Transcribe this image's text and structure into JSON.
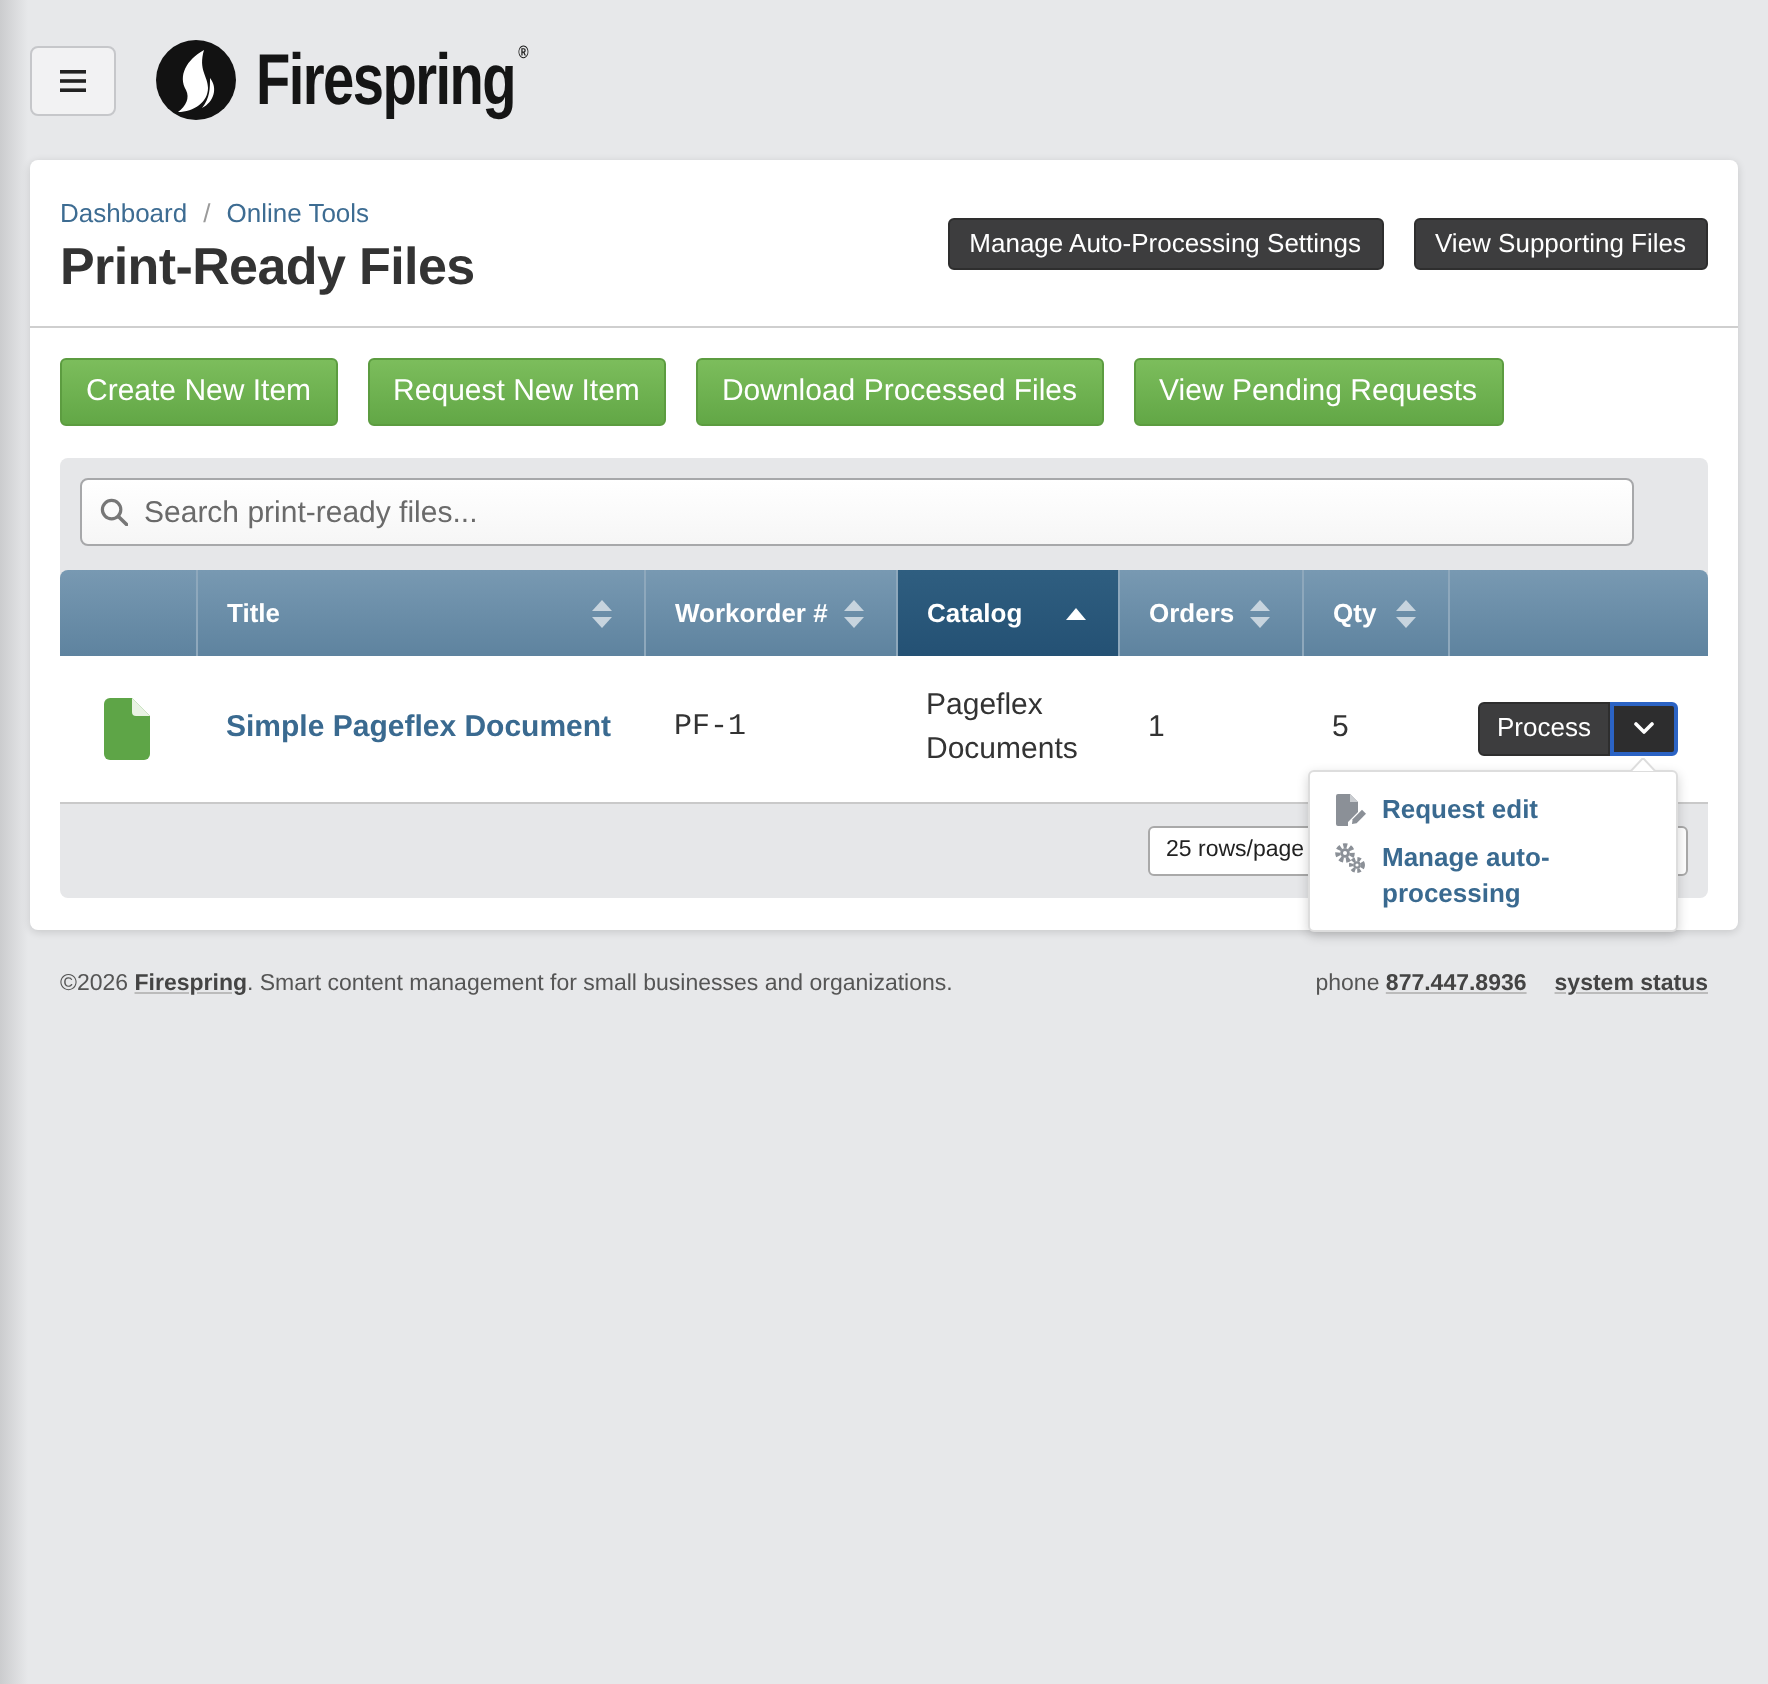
{
  "brand": "Firespring$^{®}$",
  "breadcrumb": [
    {
      "label": "Dashboard"
    },
    {
      "label": "Online Tools"
    }
  ],
  "breadcrumb_separator": "/",
  "page_title": "Print-Ready Files",
  "header_buttons": [
    "Manage Auto-Processing Settings",
    "View Supporting Files"
  ],
  "action_buttons": [
    "Create New Item",
    "Request New Item",
    "Download Processed Files",
    "View Pending Requests"
  ],
  "search": {
    "placeholder": "Search print-ready files..."
  },
  "table": {
    "columns": [
      {
        "kind": "spacer"
      },
      {
        "kind": "sortable",
        "label": "Title",
        "sorted": false
      },
      {
        "kind": "sortable",
        "label": "Workorder #",
        "sorted": false
      },
      {
        "kind": "sortable",
        "label": "Catalog",
        "sorted": true
      },
      {
        "kind": "sortable",
        "label": "Orders",
        "sorted": false
      },
      {
        "kind": "sortable",
        "label": "Qty",
        "sorted": false
      },
      {
        "kind": "spacer"
      }
    ],
    "rows": [
      {
        "title": "Simple Pageflex Document",
        "workorder": "PF-1",
        "catalog": "Pageflex Documents",
        "orders": "1",
        "qty": "5",
        "action": "Process",
        "menu_open": true,
        "menu": [
          {
            "kind": "edit",
            "label": "Request edit"
          },
          {
            "kind": "gears",
            "label": "Manage auto-processing"
          }
        ]
      }
    ],
    "rows_per_page": "25 rows/page"
  },
  "footer": {
    "copyright": {
      "prefix": "©2026",
      "link": "Firespring",
      "suffix": ". Smart content management for small businesses and organizations."
    },
    "phone": {
      "label": "phone",
      "number": "877.447.8936"
    },
    "status_link": "system status"
  }
}
